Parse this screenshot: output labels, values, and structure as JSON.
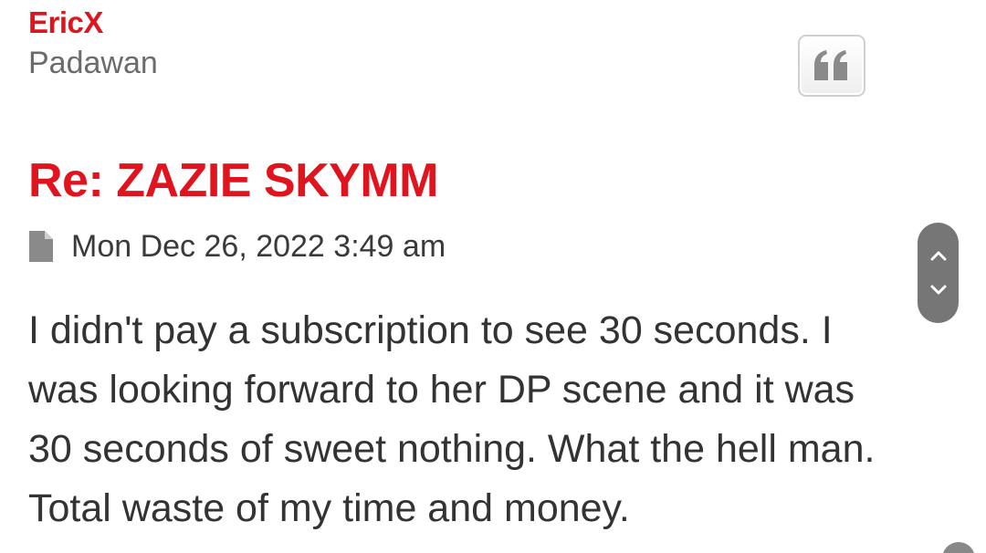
{
  "author": {
    "name": "EricX",
    "rank": "Padawan"
  },
  "actions": {
    "quote_icon": "quote-icon"
  },
  "post": {
    "title": "Re: ZAZIE SKYMM",
    "meta_icon": "document-icon",
    "date": "Mon Dec 26, 2022 3:49 am",
    "body_lines": [
      "I didn't pay a subscription to see 30 seconds. I",
      "was looking forward to her DP scene and it was",
      "30 seconds of sweet nothing. What the hell man.",
      "Total waste of my time and money."
    ]
  },
  "scroll_nav": {
    "up_icon": "chevron-up-icon",
    "down_icon": "chevron-down-icon"
  },
  "colors": {
    "accent": "#e0141e",
    "rank_text": "#6b6b6b",
    "body_text": "#333333",
    "scroll_pill": "#767676"
  }
}
